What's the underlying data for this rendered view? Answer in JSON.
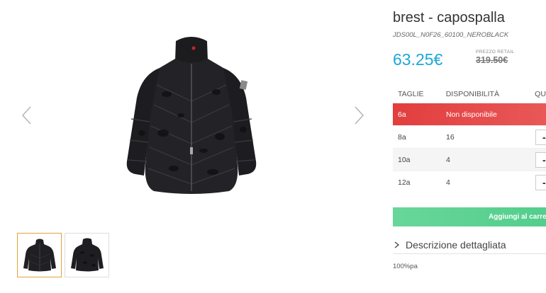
{
  "product": {
    "title": "brest - capospalla",
    "sku": "JDS00L_N0F26_60100_NEROBLACK",
    "price": "63.25€",
    "retail_label": "PREZZO RETAIL",
    "retail_price": "319.50€"
  },
  "gallery": {
    "prev_icon": "chevron-left-icon",
    "next_icon": "chevron-right-icon",
    "thumbnails": [
      "front-view",
      "back-view"
    ],
    "active_thumbnail": 0,
    "accent_color": "#e0a33b"
  },
  "sizes": {
    "headers": {
      "size": "TAGLIE",
      "availability": "DISPONIBILITÀ",
      "quantity": "QU"
    },
    "rows": [
      {
        "size": "6a",
        "availability": "Non disponibile",
        "qty": ""
      },
      {
        "size": "8a",
        "availability": "16",
        "qty": "-"
      },
      {
        "size": "10a",
        "availability": "4",
        "qty": "-"
      },
      {
        "size": "12a",
        "availability": "4",
        "qty": "-"
      }
    ],
    "unavailable_color": "#e23e3e"
  },
  "cart": {
    "label": "Aggiungi al carrel",
    "color": "#5bd291"
  },
  "description": {
    "toggle_label": "Descrizione dettagliata",
    "text": "100%pa"
  },
  "colors": {
    "price": "#1ea7d8"
  }
}
